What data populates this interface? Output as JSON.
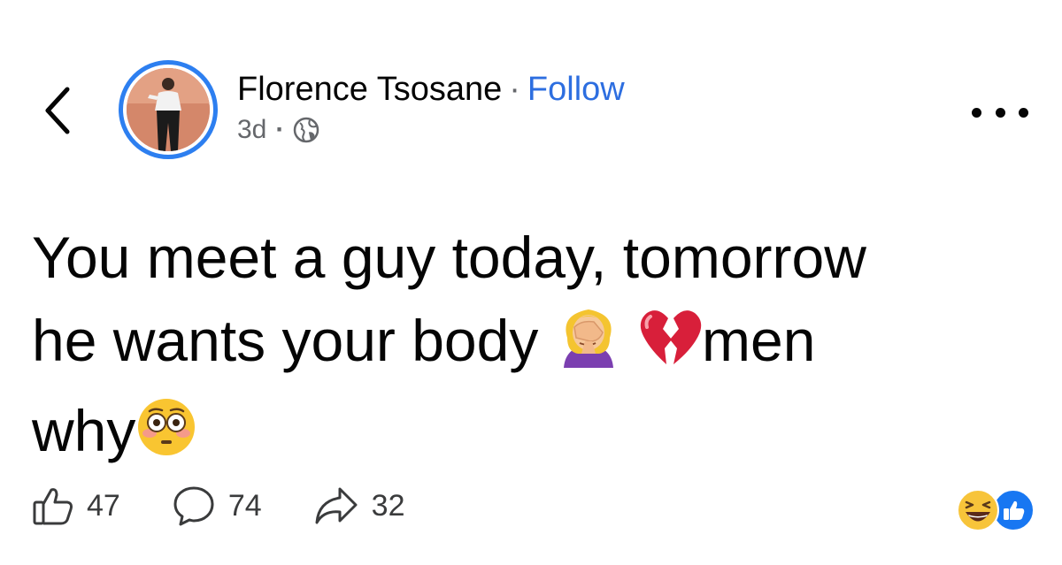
{
  "header": {
    "author_name": "Florence Tsosane",
    "separator": "·",
    "follow_label": "Follow",
    "time_ago": "3d",
    "meta_dot": "·",
    "privacy_icon": "globe-icon"
  },
  "post": {
    "line1": "You meet a guy today, tomorrow",
    "line2_text": "he wants your body ",
    "line2_after": "men",
    "line3_text": "why",
    "emojis": [
      "woman-facepalming",
      "broken-heart",
      "flushed-face"
    ]
  },
  "actions": {
    "like_count": "47",
    "comment_count": "74",
    "share_count": "32"
  },
  "reactions": [
    "haha",
    "like"
  ],
  "colors": {
    "follow": "#2d6ee0",
    "avatar_ring": "#2d7ff0",
    "like_badge": "#1877f2",
    "muted_text": "#65676b"
  }
}
